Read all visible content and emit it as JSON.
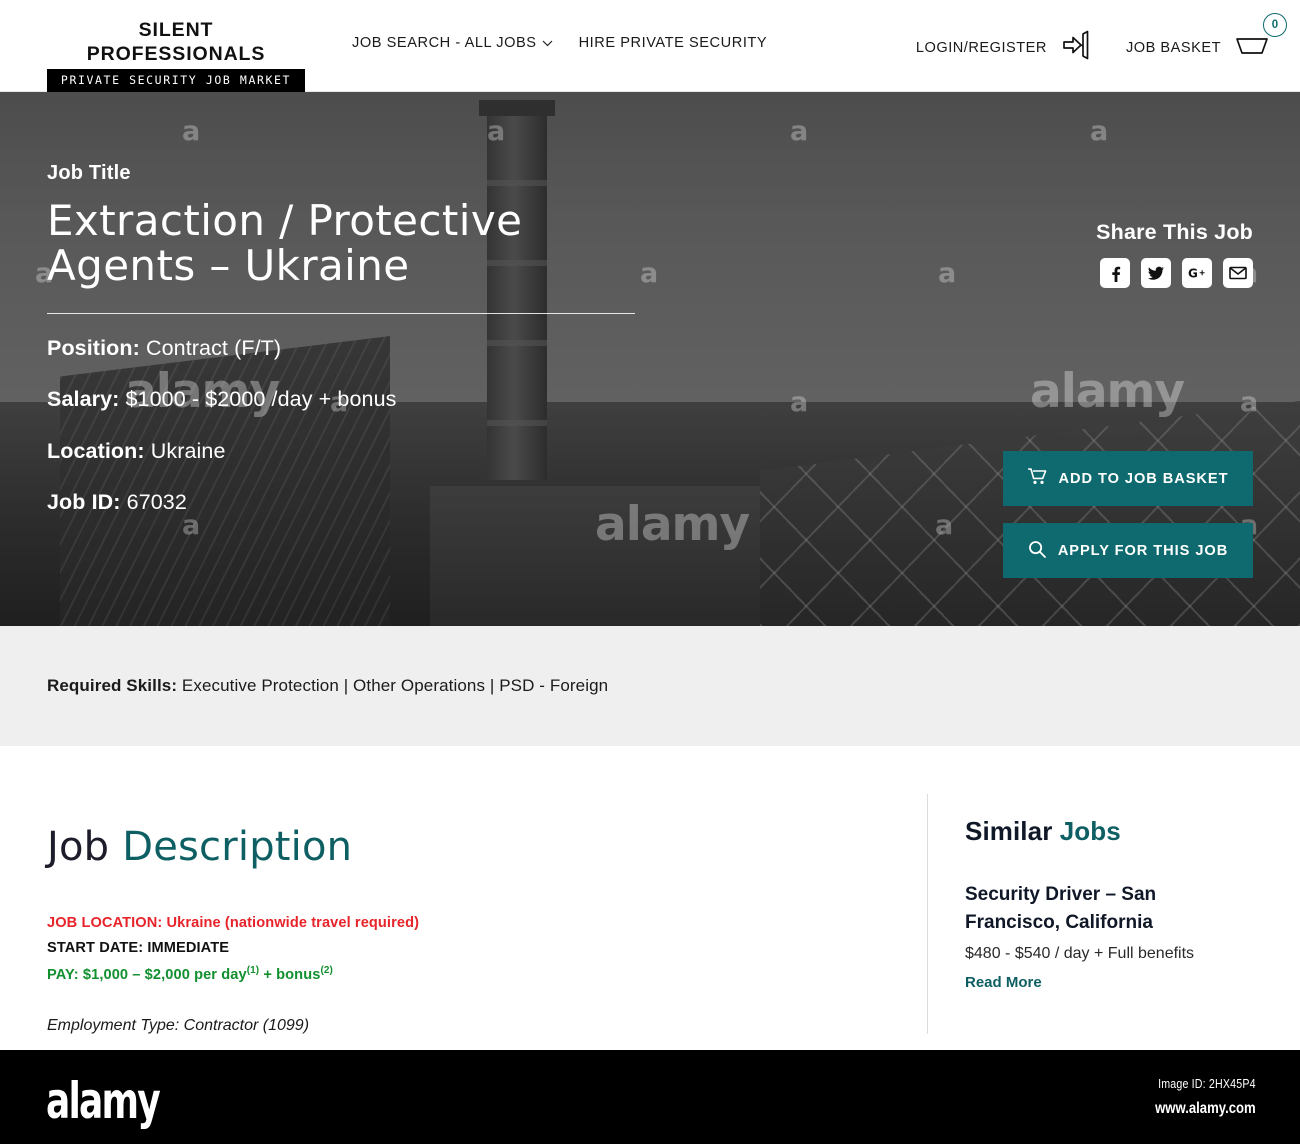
{
  "header": {
    "logo_top": "SILENT PROFESSIONALS",
    "logo_bar": "PRIVATE SECURITY JOB MARKET",
    "nav": [
      {
        "label": "JOB SEARCH - ALL JOBS",
        "has_dropdown": true,
        "chevron": "⌄"
      },
      {
        "label": "HIRE PRIVATE SECURITY",
        "has_dropdown": false
      }
    ],
    "login_label": "LOGIN/REGISTER",
    "login_icon": "login-door-icon",
    "basket_label": "JOB BASKET",
    "basket_icon": "basket-icon",
    "basket_count": "0",
    "accent_color": "#0e6a6e"
  },
  "hero": {
    "label": "Job Title",
    "title": "Extraction / Protective Agents – Ukraine",
    "meta": [
      {
        "key": "Position:",
        "value": "Contract (F/T)"
      },
      {
        "key": "Salary:",
        "value": "$1000 - $2000 /day + bonus"
      },
      {
        "key": "Location:",
        "value": "Ukraine"
      },
      {
        "key": "Job ID:",
        "value": "67032"
      }
    ],
    "share_title": "Share This Job",
    "share_icons": [
      "facebook-icon",
      "twitter-icon",
      "google-plus-icon",
      "email-icon"
    ],
    "buttons": [
      {
        "label": "ADD TO JOB BASKET",
        "icon": "cart-icon"
      },
      {
        "label": "APPLY FOR THIS JOB",
        "icon": "search-icon"
      }
    ],
    "watermark_text": "alamy",
    "watermark_letter": "a"
  },
  "skills": {
    "label": "Required Skills:",
    "value": " Executive Protection  |  Other Operations  |  PSD - Foreign"
  },
  "description": {
    "heading_part1": "Job ",
    "heading_part2": "Description",
    "location_line": "JOB LOCATION:  Ukraine (nationwide travel required)",
    "start_line": "START DATE: IMMEDIATE",
    "pay_line": "PAY: $1,000 – $2,000 per day",
    "pay_sup1": "(1)",
    "pay_mid": " + bonus",
    "pay_sup2": "(2)",
    "employment_line": "Employment Type: Contractor (1099)",
    "color_red": "#e8242b",
    "color_green": "#12902f"
  },
  "similar": {
    "heading_part1": "Similar ",
    "heading_part2": "Jobs",
    "items": [
      {
        "title": "Security Driver – San Francisco, California",
        "pay": "$480 - $540 / day + Full benefits",
        "link": "Read More"
      }
    ]
  },
  "footer": {
    "logo": "alamy",
    "image_id": "Image ID: 2HX45P4",
    "url": "www.alamy.com"
  }
}
